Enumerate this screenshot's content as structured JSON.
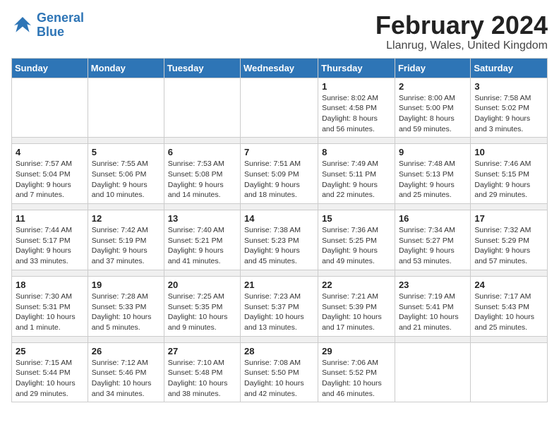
{
  "header": {
    "logo_line1": "General",
    "logo_line2": "Blue",
    "month": "February 2024",
    "location": "Llanrug, Wales, United Kingdom"
  },
  "weekdays": [
    "Sunday",
    "Monday",
    "Tuesday",
    "Wednesday",
    "Thursday",
    "Friday",
    "Saturday"
  ],
  "weeks": [
    [
      {
        "day": "",
        "info": ""
      },
      {
        "day": "",
        "info": ""
      },
      {
        "day": "",
        "info": ""
      },
      {
        "day": "",
        "info": ""
      },
      {
        "day": "1",
        "info": "Sunrise: 8:02 AM\nSunset: 4:58 PM\nDaylight: 8 hours\nand 56 minutes."
      },
      {
        "day": "2",
        "info": "Sunrise: 8:00 AM\nSunset: 5:00 PM\nDaylight: 8 hours\nand 59 minutes."
      },
      {
        "day": "3",
        "info": "Sunrise: 7:58 AM\nSunset: 5:02 PM\nDaylight: 9 hours\nand 3 minutes."
      }
    ],
    [
      {
        "day": "4",
        "info": "Sunrise: 7:57 AM\nSunset: 5:04 PM\nDaylight: 9 hours\nand 7 minutes."
      },
      {
        "day": "5",
        "info": "Sunrise: 7:55 AM\nSunset: 5:06 PM\nDaylight: 9 hours\nand 10 minutes."
      },
      {
        "day": "6",
        "info": "Sunrise: 7:53 AM\nSunset: 5:08 PM\nDaylight: 9 hours\nand 14 minutes."
      },
      {
        "day": "7",
        "info": "Sunrise: 7:51 AM\nSunset: 5:09 PM\nDaylight: 9 hours\nand 18 minutes."
      },
      {
        "day": "8",
        "info": "Sunrise: 7:49 AM\nSunset: 5:11 PM\nDaylight: 9 hours\nand 22 minutes."
      },
      {
        "day": "9",
        "info": "Sunrise: 7:48 AM\nSunset: 5:13 PM\nDaylight: 9 hours\nand 25 minutes."
      },
      {
        "day": "10",
        "info": "Sunrise: 7:46 AM\nSunset: 5:15 PM\nDaylight: 9 hours\nand 29 minutes."
      }
    ],
    [
      {
        "day": "11",
        "info": "Sunrise: 7:44 AM\nSunset: 5:17 PM\nDaylight: 9 hours\nand 33 minutes."
      },
      {
        "day": "12",
        "info": "Sunrise: 7:42 AM\nSunset: 5:19 PM\nDaylight: 9 hours\nand 37 minutes."
      },
      {
        "day": "13",
        "info": "Sunrise: 7:40 AM\nSunset: 5:21 PM\nDaylight: 9 hours\nand 41 minutes."
      },
      {
        "day": "14",
        "info": "Sunrise: 7:38 AM\nSunset: 5:23 PM\nDaylight: 9 hours\nand 45 minutes."
      },
      {
        "day": "15",
        "info": "Sunrise: 7:36 AM\nSunset: 5:25 PM\nDaylight: 9 hours\nand 49 minutes."
      },
      {
        "day": "16",
        "info": "Sunrise: 7:34 AM\nSunset: 5:27 PM\nDaylight: 9 hours\nand 53 minutes."
      },
      {
        "day": "17",
        "info": "Sunrise: 7:32 AM\nSunset: 5:29 PM\nDaylight: 9 hours\nand 57 minutes."
      }
    ],
    [
      {
        "day": "18",
        "info": "Sunrise: 7:30 AM\nSunset: 5:31 PM\nDaylight: 10 hours\nand 1 minute."
      },
      {
        "day": "19",
        "info": "Sunrise: 7:28 AM\nSunset: 5:33 PM\nDaylight: 10 hours\nand 5 minutes."
      },
      {
        "day": "20",
        "info": "Sunrise: 7:25 AM\nSunset: 5:35 PM\nDaylight: 10 hours\nand 9 minutes."
      },
      {
        "day": "21",
        "info": "Sunrise: 7:23 AM\nSunset: 5:37 PM\nDaylight: 10 hours\nand 13 minutes."
      },
      {
        "day": "22",
        "info": "Sunrise: 7:21 AM\nSunset: 5:39 PM\nDaylight: 10 hours\nand 17 minutes."
      },
      {
        "day": "23",
        "info": "Sunrise: 7:19 AM\nSunset: 5:41 PM\nDaylight: 10 hours\nand 21 minutes."
      },
      {
        "day": "24",
        "info": "Sunrise: 7:17 AM\nSunset: 5:43 PM\nDaylight: 10 hours\nand 25 minutes."
      }
    ],
    [
      {
        "day": "25",
        "info": "Sunrise: 7:15 AM\nSunset: 5:44 PM\nDaylight: 10 hours\nand 29 minutes."
      },
      {
        "day": "26",
        "info": "Sunrise: 7:12 AM\nSunset: 5:46 PM\nDaylight: 10 hours\nand 34 minutes."
      },
      {
        "day": "27",
        "info": "Sunrise: 7:10 AM\nSunset: 5:48 PM\nDaylight: 10 hours\nand 38 minutes."
      },
      {
        "day": "28",
        "info": "Sunrise: 7:08 AM\nSunset: 5:50 PM\nDaylight: 10 hours\nand 42 minutes."
      },
      {
        "day": "29",
        "info": "Sunrise: 7:06 AM\nSunset: 5:52 PM\nDaylight: 10 hours\nand 46 minutes."
      },
      {
        "day": "",
        "info": ""
      },
      {
        "day": "",
        "info": ""
      }
    ]
  ]
}
